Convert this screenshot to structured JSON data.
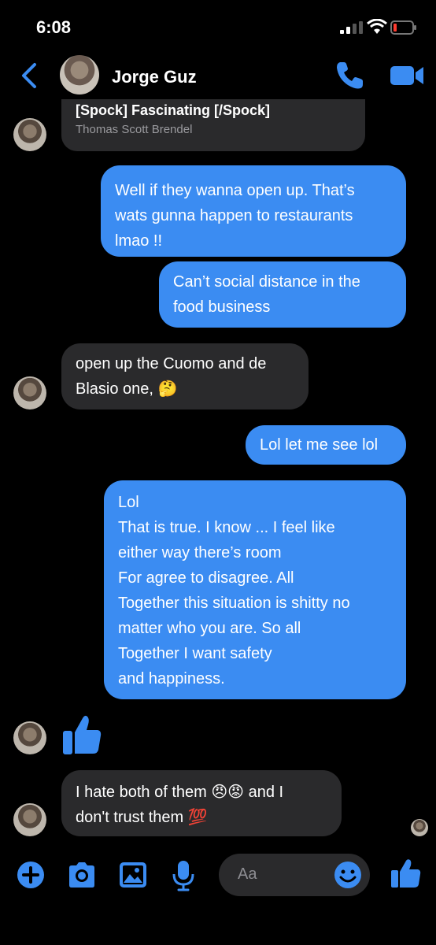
{
  "status_bar": {
    "time": "6:08"
  },
  "header": {
    "contact_name": "Jorge Guz"
  },
  "messages": [
    {
      "quote_title": "[Spock] Fascinating [/Spock]",
      "quote_author": "Thomas Scott Brendel"
    },
    {
      "lines": [
        "Well if they wanna open up. That’s",
        "wats gunna happen to restaurants",
        "lmao !!"
      ]
    },
    {
      "lines": [
        "Can’t social distance in the",
        "food business"
      ]
    },
    {
      "lines": [
        "open up the Cuomo and de",
        "Blasio one, 🤔"
      ]
    },
    {
      "lines": [
        "Lol let me see lol"
      ]
    },
    {
      "lines": [
        "Lol",
        "That is true. I know ... I feel like",
        "either way there’s room",
        "For agree to disagree. All",
        "Together this situation is shitty no",
        "matter who you are. So all",
        "Together I want safety",
        "and happiness."
      ]
    },
    {
      "lines": [
        "I hate both of them 😠😡 and I",
        "don't trust them 💯"
      ]
    }
  ],
  "composer": {
    "placeholder": "Aa"
  },
  "colors": {
    "accent": "#3b8cf2",
    "incoming_bubble": "#2a2a2c",
    "background": "#000000"
  },
  "icons": [
    "back-chevron-icon",
    "phone-icon",
    "video-camera-icon",
    "plus-icon",
    "camera-icon",
    "image-icon",
    "microphone-icon",
    "emoji-icon",
    "thumbs-up-icon"
  ]
}
